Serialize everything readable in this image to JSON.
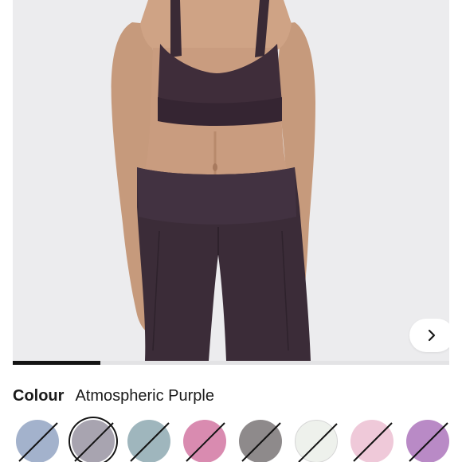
{
  "colour": {
    "label": "Colour",
    "selected_name": "Atmospheric Purple"
  },
  "carousel": {
    "next_icon": "chevron-right-icon",
    "progress_fraction": 0.2
  },
  "swatches": [
    {
      "color": "#a3b2cc",
      "available": false,
      "selected": false
    },
    {
      "color": "#a8a4b0",
      "available": false,
      "selected": true
    },
    {
      "color": "#9fb6bd",
      "available": false,
      "selected": false
    },
    {
      "color": "#d98bb0",
      "available": false,
      "selected": false
    },
    {
      "color": "#8e8a8b",
      "available": false,
      "selected": false
    },
    {
      "color": "#eef1ec",
      "available": false,
      "selected": false
    },
    {
      "color": "#efc9d9",
      "available": false,
      "selected": false
    },
    {
      "color": "#b98ac6",
      "available": false,
      "selected": false
    }
  ]
}
